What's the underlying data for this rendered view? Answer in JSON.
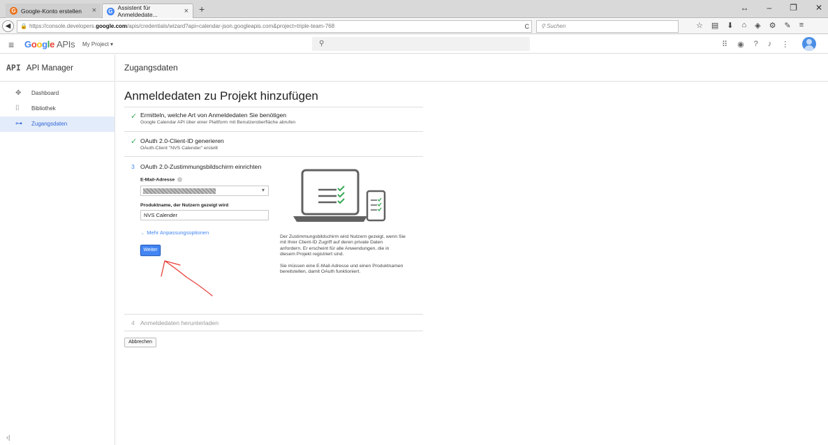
{
  "browser": {
    "tabs": [
      {
        "title": "Google-Konto erstellen"
      },
      {
        "title": "Assistent für Anmeldedate..."
      }
    ],
    "url_prefix": "https://console.developers.",
    "url_domain": "google.com",
    "url_path": "/apis/credentials/wizard?api=calendar-json.googleapis.com&project=triple-team-768",
    "search_placeholder": "Suchen"
  },
  "header": {
    "logo_letters": [
      "G",
      "o",
      "o",
      "g",
      "l",
      "e"
    ],
    "logo_suffix": "APIs",
    "project": "My Project"
  },
  "sidebar": {
    "title_logo": "API",
    "title": "API Manager",
    "items": [
      {
        "label": "Dashboard",
        "icon": "dashboard-icon"
      },
      {
        "label": "Bibliothek",
        "icon": "library-icon"
      },
      {
        "label": "Zugangsdaten",
        "icon": "key-icon",
        "active": true
      }
    ]
  },
  "page": {
    "header": "Zugangsdaten",
    "title": "Anmeldedaten zu Projekt hinzufügen"
  },
  "steps": {
    "step1": {
      "title": "Ermitteln, welche Art von Anmeldedaten Sie benötigen",
      "subtitle": "Google Calendar API über einer Plattform mit Benutzeroberfläche abrufen"
    },
    "step2": {
      "title": "OAuth 2.0-Client-ID generieren",
      "subtitle": "OAuth-Client \"NVS Calender\" erstellt"
    },
    "step3": {
      "number": "3",
      "title": "OAuth 2.0-Zustimmungsbildschirm einrichten"
    },
    "step4": {
      "number": "4",
      "title": "Anmeldedaten herunterladen"
    }
  },
  "form": {
    "email_label": "E-Mail-Adresse",
    "product_label": "Produktname, der Nutzern gezeigt wird",
    "product_value": "NVS Calender",
    "more_options": "Mehr Anpassungsoptionen",
    "next_button": "Weiter",
    "cancel_button": "Abbrechen"
  },
  "info": {
    "paragraph1": "Der Zustimmungsbildschirm wird Nutzern gezeigt, wenn Sie mit Ihrer Client-ID Zugriff auf deren private Daten anfordern. Er erscheint für alle Anwendungen, die in diesem Projekt registriert sind.",
    "paragraph2": "Sie müssen eine E-Mail-Adresse und einen Produktnamen bereitstellen, damit OAuth funktioniert."
  },
  "colors": {
    "primary": "#4285f4",
    "check": "#34a853",
    "annotation": "#e8403a"
  }
}
